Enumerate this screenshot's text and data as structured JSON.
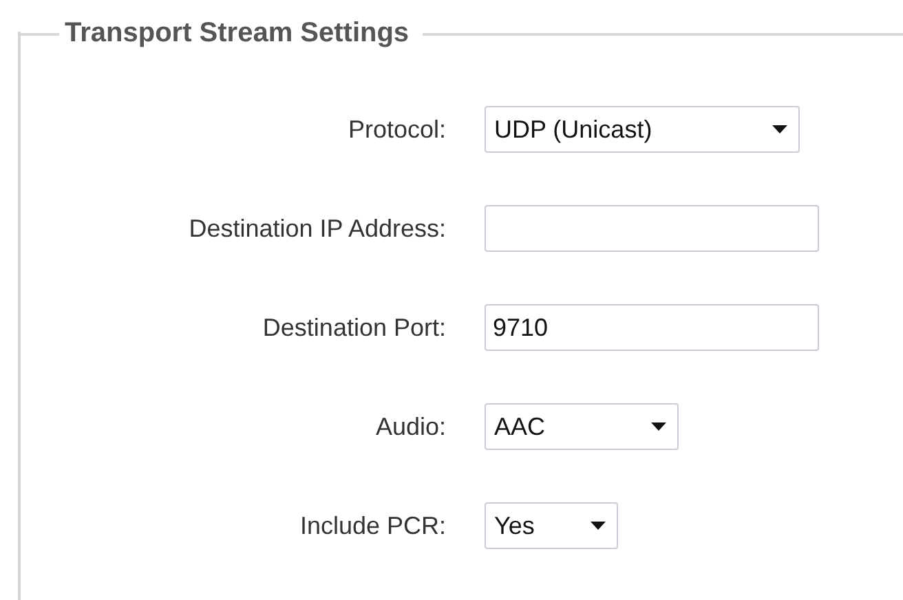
{
  "section": {
    "title": "Transport Stream Settings"
  },
  "fields": [
    {
      "kind": "select",
      "label": "Protocol:",
      "value": "UDP (Unicast)"
    },
    {
      "kind": "text",
      "label": "Destination IP Address:"
    },
    {
      "kind": "text",
      "label": "Destination Port:",
      "value": "9710"
    },
    {
      "kind": "select",
      "label": "Audio:",
      "value": "AAC"
    },
    {
      "kind": "select",
      "label": "Include PCR:",
      "value": "Yes"
    }
  ]
}
